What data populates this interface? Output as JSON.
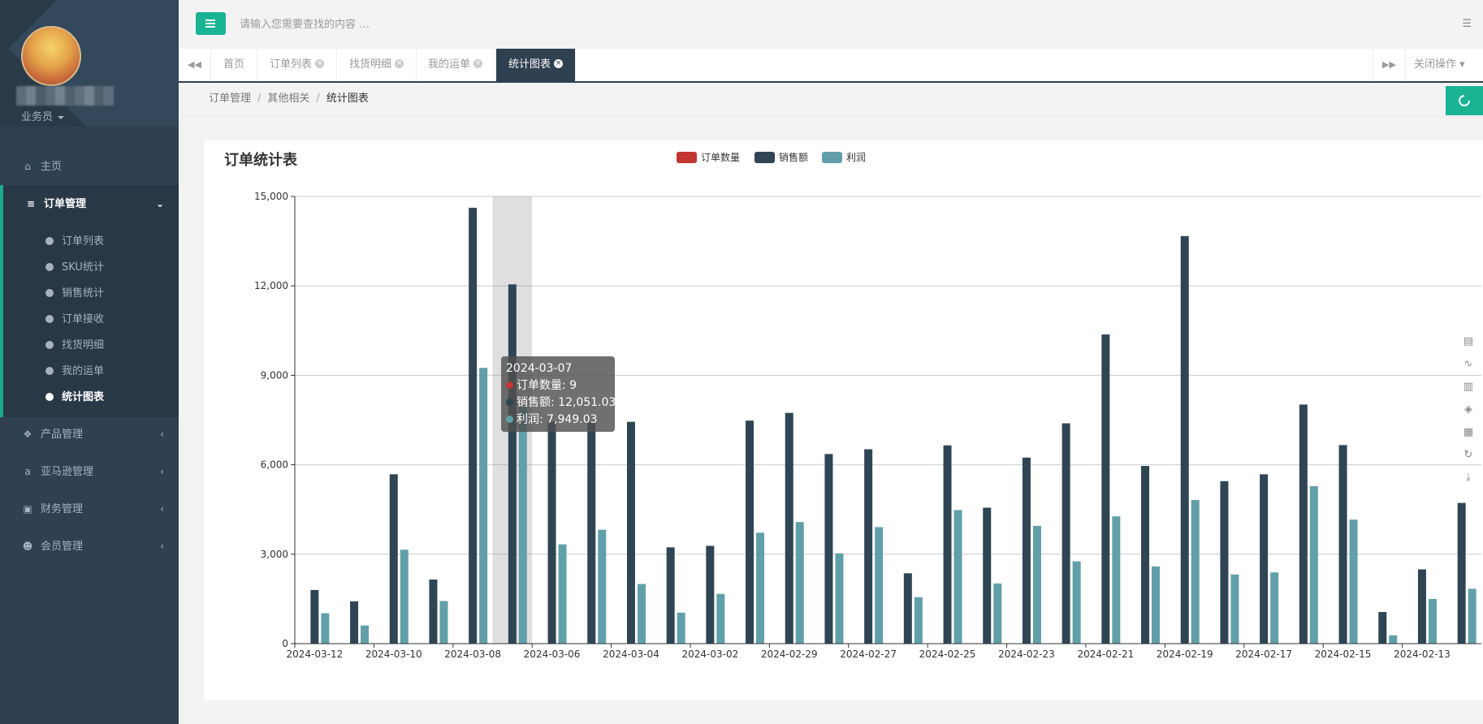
{
  "sidebar": {
    "role": "业务员",
    "nav": {
      "home": "主页",
      "order_mgmt": "订单管理",
      "product_mgmt": "产品管理",
      "amazon_mgmt": "亚马逊管理",
      "finance_mgmt": "财务管理",
      "member_mgmt": "会员管理"
    },
    "submenu": [
      "订单列表",
      "SKU统计",
      "销售统计",
      "订单接收",
      "找货明细",
      "我的运单",
      "统计图表"
    ],
    "accent_color": "#19aa8d"
  },
  "topbar": {
    "search_placeholder": "请输入您需要查找的内容 …"
  },
  "tabs": {
    "items": [
      {
        "label": "首页",
        "closable": false,
        "active": false
      },
      {
        "label": "订单列表",
        "closable": true,
        "active": false
      },
      {
        "label": "找货明细",
        "closable": true,
        "active": false
      },
      {
        "label": "我的运单",
        "closable": true,
        "active": false
      },
      {
        "label": "统计图表",
        "closable": true,
        "active": true
      }
    ],
    "close_ops": "关闭操作"
  },
  "breadcrumb": [
    "订单管理",
    "其他相关",
    "统计图表"
  ],
  "chart_data": {
    "type": "bar",
    "title": "订单统计表",
    "legend": [
      "订单数量",
      "销售额",
      "利润"
    ],
    "legend_placement": "top-center",
    "colors": [
      "#c23531",
      "#2f4554",
      "#61a0a8"
    ],
    "ylim": [
      0,
      15000
    ],
    "yticks": [
      "0",
      "3,000",
      "6,000",
      "9,000",
      "12,000",
      "15,000"
    ],
    "xtick_labels": [
      "2024-03-12",
      "2024-03-10",
      "2024-03-08",
      "2024-03-06",
      "2024-03-04",
      "2024-03-02",
      "2024-02-29",
      "2024-02-27",
      "2024-02-25",
      "2024-02-23",
      "2024-02-21",
      "2024-02-19",
      "2024-02-17",
      "2024-02-15",
      "2024-02-13"
    ],
    "categories": [
      "2024-03-12",
      "2024-03-11",
      "2024-03-10",
      "2024-03-09",
      "2024-03-08",
      "2024-03-07",
      "2024-03-06",
      "2024-03-05",
      "2024-03-04",
      "2024-03-03",
      "2024-03-02",
      "2024-03-01",
      "2024-02-29",
      "2024-02-28",
      "2024-02-27",
      "2024-02-26",
      "2024-02-25",
      "2024-02-24",
      "2024-02-23",
      "2024-02-22",
      "2024-02-21",
      "2024-02-20",
      "2024-02-19",
      "2024-02-18",
      "2024-02-17",
      "2024-02-16",
      "2024-02-15",
      "2024-02-14",
      "2024-02-13",
      "2024-02-12"
    ],
    "series": [
      {
        "name": "订单数量",
        "values": [
          2,
          2,
          5,
          3,
          10,
          9,
          7,
          6,
          6,
          3,
          3,
          6,
          6,
          5,
          5,
          2,
          5,
          4,
          5,
          6,
          8,
          5,
          10,
          4,
          4,
          6,
          5,
          1,
          2,
          4
        ]
      },
      {
        "name": "销售额",
        "values": [
          1800,
          1420,
          5680,
          2150,
          14620,
          12051.03,
          7450,
          7440,
          7440,
          3230,
          3280,
          7480,
          7740,
          6360,
          6520,
          2360,
          6650,
          4560,
          6240,
          7390,
          10370,
          5960,
          13670,
          5450,
          5680,
          8020,
          6660,
          1060,
          2490,
          4720
        ]
      },
      {
        "name": "利润",
        "values": [
          1020,
          610,
          3150,
          1430,
          9250,
          7949.03,
          3330,
          3820,
          2000,
          1040,
          1670,
          3720,
          4080,
          3030,
          3910,
          1560,
          4480,
          2020,
          3950,
          2760,
          4270,
          2590,
          4820,
          2320,
          2390,
          5280,
          4160,
          280,
          1500,
          1840
        ]
      }
    ],
    "highlighted_category": "2024-03-07",
    "grid": true
  },
  "tooltip": {
    "date": "2024-03-07",
    "rows": [
      {
        "text": "订单数量: 9",
        "color": "#c23531"
      },
      {
        "text": "销售额: 12,051.03",
        "color": "#2f4554"
      },
      {
        "text": "利润: 7,949.03",
        "color": "#61a0a8"
      }
    ]
  },
  "toolbox_icons": [
    "data-view-icon",
    "line-chart-icon",
    "bar-chart-icon",
    "stack-icon",
    "tiled-icon",
    "restore-icon",
    "save-image-icon"
  ]
}
